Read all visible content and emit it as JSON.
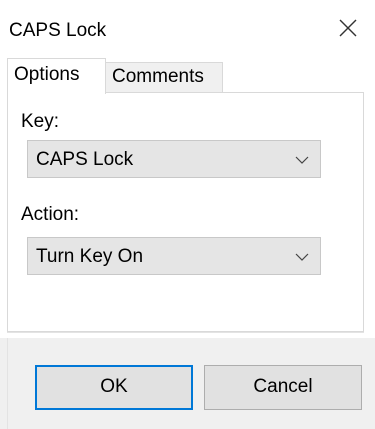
{
  "window": {
    "title": "CAPS Lock"
  },
  "tabs": [
    {
      "label": "Options",
      "selected": true
    },
    {
      "label": "Comments",
      "selected": false
    }
  ],
  "form": {
    "key_label": "Key:",
    "key_value": "CAPS Lock",
    "action_label": "Action:",
    "action_value": "Turn Key On"
  },
  "buttons": {
    "ok": "OK",
    "cancel": "Cancel"
  },
  "icons": {
    "close": "close-icon",
    "dropdown": "chevron-down-icon"
  },
  "colors": {
    "focus_border": "#0078d7",
    "button_bg": "#e1e1e1",
    "select_bg": "#e5e5e5"
  }
}
